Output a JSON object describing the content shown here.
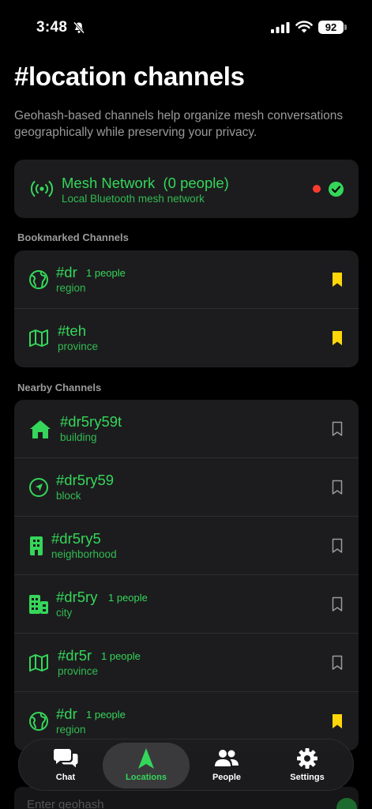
{
  "status": {
    "time": "3:48",
    "battery": "92"
  },
  "title": "#location channels",
  "subtitle": "Geohash-based channels help organize mesh conversations geographically while preserving your privacy.",
  "mesh": {
    "title": "Mesh Network",
    "people": "(0 people)",
    "subtitle": "Local Bluetooth mesh network"
  },
  "sections": {
    "bookmarked": "Bookmarked Channels",
    "nearby": "Nearby Channels"
  },
  "bookmarked": [
    {
      "name": "#dr",
      "people": "1 people",
      "level": "region",
      "icon": "globe-icon",
      "bookmarked": true
    },
    {
      "name": "#teh",
      "people": "",
      "level": "province",
      "icon": "map-icon",
      "bookmarked": true
    }
  ],
  "nearby": [
    {
      "name": "#dr5ry59t",
      "people": "",
      "level": "building",
      "icon": "house-icon",
      "bookmarked": false
    },
    {
      "name": "#dr5ry59",
      "people": "",
      "level": "block",
      "icon": "location-arrow-icon",
      "bookmarked": false
    },
    {
      "name": "#dr5ry5",
      "people": "",
      "level": "neighborhood",
      "icon": "tower-building-icon",
      "bookmarked": false
    },
    {
      "name": "#dr5ry",
      "people": "1 people",
      "level": "city",
      "icon": "city-buildings-icon",
      "bookmarked": false
    },
    {
      "name": "#dr5r",
      "people": "1 people",
      "level": "province",
      "icon": "map-icon",
      "bookmarked": false
    },
    {
      "name": "#dr",
      "people": "1 people",
      "level": "region",
      "icon": "globe-icon",
      "bookmarked": true
    }
  ],
  "input": {
    "placeholder": "Enter geohash"
  },
  "tabs": [
    {
      "label": "Chat",
      "icon": "chat-bubbles-icon"
    },
    {
      "label": "Locations",
      "icon": "location-arrow-up-icon",
      "active": true
    },
    {
      "label": "People",
      "icon": "people-icon"
    },
    {
      "label": "Settings",
      "icon": "gear-icon"
    }
  ],
  "colors": {
    "accent": "#35d65a",
    "bookmark": "#ffd60a",
    "alert": "#ff3b30",
    "card": "#1c1c1e"
  }
}
